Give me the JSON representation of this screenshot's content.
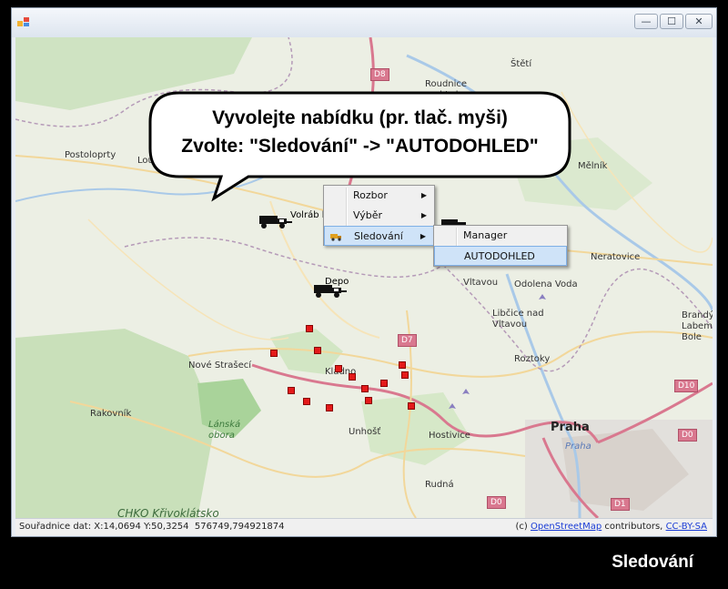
{
  "window": {
    "buttons": {
      "minimize": "—",
      "maximize": "☐",
      "close": "✕"
    }
  },
  "callout": {
    "line1": "Vyvolejte nabídku (pr. tlač. myši)",
    "line2": "Zvolte: \"Sledování\" -> \"AUTODOHLED\""
  },
  "context_menu": {
    "items": [
      {
        "label": "Rozbor",
        "has_submenu": true
      },
      {
        "label": "Výběr",
        "has_submenu": true
      },
      {
        "label": "Sledování",
        "has_submenu": true,
        "selected": true
      }
    ],
    "arrow": "▶"
  },
  "submenu": {
    "items": [
      {
        "label": "Manager"
      },
      {
        "label": "AUTODOHLED",
        "selected": true
      }
    ]
  },
  "map": {
    "vehicles": [
      {
        "label": "Volráb konec"
      },
      {
        "label": "Depo"
      }
    ],
    "places": [
      "Roudnice nad Labem",
      "Štětí",
      "Postoloprty",
      "Lou",
      "Mělník",
      "Neratovice",
      "Odolena Voda",
      "Vltavou",
      "Libčice nad Vltavou",
      "Brandý Labem-Bole",
      "Nové Strašecí",
      "Kladno",
      "Roztoky",
      "Rakovník",
      "Lánská obora",
      "Unhošť",
      "Hostivice",
      "Praha",
      "Rudná",
      "CHKO Křivoklátsko",
      "Praha"
    ],
    "road_shields": [
      "D8",
      "D7",
      "D10",
      "D0",
      "D0",
      "D1"
    ]
  },
  "statusbar": {
    "coords": "Souřadnice dat: X:14,0694 Y:50,3254",
    "projected": "576749,794921874",
    "copyright_prefix": "(c)",
    "osm_link": "OpenStreetMap",
    "contributors": "contributors,",
    "license_link": "CC-BY-SA"
  },
  "caption": "Sledování",
  "colors": {
    "marker": "#e41a1a",
    "menu_selected": "#cfe3f8",
    "highway": "#d9788f"
  }
}
